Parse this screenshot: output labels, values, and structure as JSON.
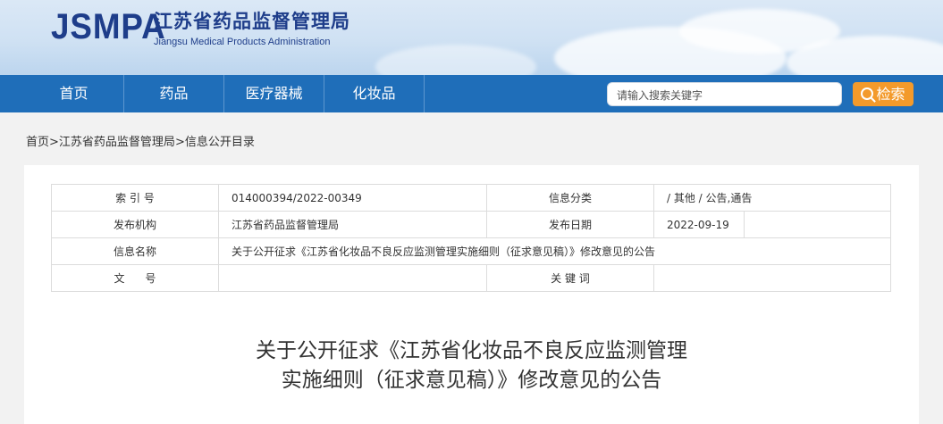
{
  "header": {
    "logo_text": "JSMPA",
    "agency_cn": "江苏省药品监督管理局",
    "agency_en": "Jiangsu Medical Products Administration"
  },
  "nav": {
    "items": [
      "首页",
      "药品",
      "医疗器械",
      "化妆品"
    ],
    "search_placeholder": "请输入搜索关键字",
    "search_button": "检索"
  },
  "breadcrumb": {
    "home": "首页",
    "sep": ">",
    "level1": "江苏省药品监督管理局",
    "level2": "信息公开目录"
  },
  "meta": {
    "index_label": "索 引 号",
    "index_value": "014000394/2022-00349",
    "category_label": "信息分类",
    "category_value": "/  其他  /  公告,通告",
    "publisher_label": "发布机构",
    "publisher_value": "江苏省药品监督管理局",
    "date_label": "发布日期",
    "date_value": "2022-09-19",
    "name_label": "信息名称",
    "name_value": "关于公开征求《江苏省化妆品不良反应监测管理实施细则（征求意见稿）》修改意见的公告",
    "doc_no_label": "文      号",
    "doc_no_value": "",
    "keywords_label": "关 键 词",
    "keywords_value": ""
  },
  "document": {
    "title_line1": "关于公开征求《江苏省化妆品不良反应监测管理",
    "title_line2": "实施细则（征求意见稿）》修改意见的公告"
  }
}
